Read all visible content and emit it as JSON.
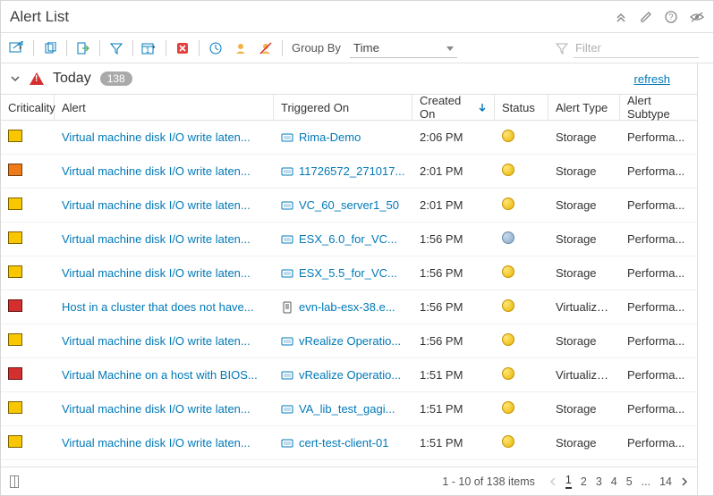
{
  "header": {
    "title": "Alert List"
  },
  "toolbar": {
    "group_by_label": "Group By",
    "group_by_value": "Time"
  },
  "filter": {
    "placeholder": "Filter"
  },
  "group": {
    "title": "Today",
    "count": "138",
    "refresh": "refresh"
  },
  "columns": {
    "criticality": "Criticality",
    "alert": "Alert",
    "triggered": "Triggered On",
    "created": "Created On",
    "status": "Status",
    "type": "Alert Type",
    "subtype": "Alert Subtype"
  },
  "rows": [
    {
      "crit": "yellow",
      "alert": "Virtual machine disk I/O write laten...",
      "trig_icon": "vm",
      "trig": "Rima-Demo",
      "created": "2:06 PM",
      "status": "warn",
      "type": "Storage",
      "subtype": "Performa..."
    },
    {
      "crit": "orange",
      "alert": "Virtual machine disk I/O write laten...",
      "trig_icon": "vm",
      "trig": "11726572_271017...",
      "created": "2:01 PM",
      "status": "warn",
      "type": "Storage",
      "subtype": "Performa..."
    },
    {
      "crit": "yellow",
      "alert": "Virtual machine disk I/O write laten...",
      "trig_icon": "vm",
      "trig": "VC_60_server1_50",
      "created": "2:01 PM",
      "status": "warn",
      "type": "Storage",
      "subtype": "Performa..."
    },
    {
      "crit": "yellow",
      "alert": "Virtual machine disk I/O write laten...",
      "trig_icon": "vm",
      "trig": "ESX_6.0_for_VC...",
      "created": "1:56 PM",
      "status": "info",
      "type": "Storage",
      "subtype": "Performa..."
    },
    {
      "crit": "yellow",
      "alert": "Virtual machine disk I/O write laten...",
      "trig_icon": "vm",
      "trig": "ESX_5.5_for_VC...",
      "created": "1:56 PM",
      "status": "warn",
      "type": "Storage",
      "subtype": "Performa..."
    },
    {
      "crit": "red",
      "alert": "Host in a cluster that does not have...",
      "trig_icon": "host",
      "trig": "evn-lab-esx-38.e...",
      "created": "1:56 PM",
      "status": "warn",
      "type": "Virtualiza...",
      "subtype": "Performa..."
    },
    {
      "crit": "yellow",
      "alert": "Virtual machine disk I/O write laten...",
      "trig_icon": "vm",
      "trig": "vRealize Operatio...",
      "created": "1:56 PM",
      "status": "warn",
      "type": "Storage",
      "subtype": "Performa..."
    },
    {
      "crit": "red",
      "alert": "Virtual Machine on a host with BIOS...",
      "trig_icon": "vm",
      "trig": "vRealize Operatio...",
      "created": "1:51 PM",
      "status": "warn",
      "type": "Virtualiza...",
      "subtype": "Performa..."
    },
    {
      "crit": "yellow",
      "alert": "Virtual machine disk I/O write laten...",
      "trig_icon": "vm",
      "trig": "VA_lib_test_gagi...",
      "created": "1:51 PM",
      "status": "warn",
      "type": "Storage",
      "subtype": "Performa..."
    },
    {
      "crit": "yellow",
      "alert": "Virtual machine disk I/O write laten...",
      "trig_icon": "vm",
      "trig": "cert-test-client-01",
      "created": "1:51 PM",
      "status": "warn",
      "type": "Storage",
      "subtype": "Performa..."
    }
  ],
  "footer": {
    "range": "1 - 10 of 138 items",
    "pages": [
      "1",
      "2",
      "3",
      "4",
      "5",
      "...",
      "14"
    ],
    "current_page": "1"
  }
}
